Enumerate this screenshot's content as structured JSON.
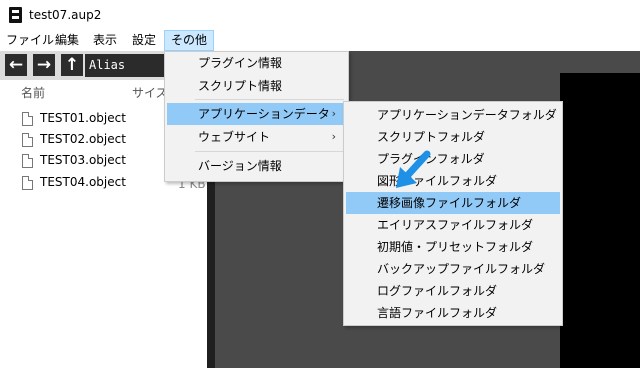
{
  "window": {
    "title": "test07.aup2"
  },
  "menubar": {
    "items": [
      {
        "label": "ファイル"
      },
      {
        "label": "編集"
      },
      {
        "label": "表示"
      },
      {
        "label": "設定"
      },
      {
        "label": "その他"
      }
    ]
  },
  "toolbar": {
    "back": "←",
    "forward": "→",
    "up": "↑",
    "path": "Alias"
  },
  "file_list": {
    "columns": [
      "名前",
      "サイズ"
    ],
    "files": [
      {
        "name": "TEST01.object"
      },
      {
        "name": "TEST02.object"
      },
      {
        "name": "TEST03.object"
      },
      {
        "name": "TEST04.object",
        "size": "1 KB"
      }
    ]
  },
  "other_menu": {
    "items": [
      "プラグイン情報",
      "スクリプト情報",
      "アプリケーションデータ",
      "ウェブサイト",
      "バージョン情報"
    ],
    "submenu_arrow": "›"
  },
  "app_data_submenu": {
    "items": [
      "アプリケーションデータフォルダ",
      "スクリプトフォルダ",
      "プラグインフォルダ",
      "図形ファイルフォルダ",
      "遷移画像ファイルフォルダ",
      "エイリアスファイルフォルダ",
      "初期値・プリセットフォルダ",
      "バックアップファイルフォルダ",
      "ログファイルフォルダ",
      "言語ファイルフォルダ"
    ],
    "highlighted_index": 4
  },
  "colors": {
    "highlight": "#91c9f7",
    "pointer_arrow": "#1e90e6"
  },
  "pointer": {
    "icon": "down-left-arrow-icon"
  }
}
